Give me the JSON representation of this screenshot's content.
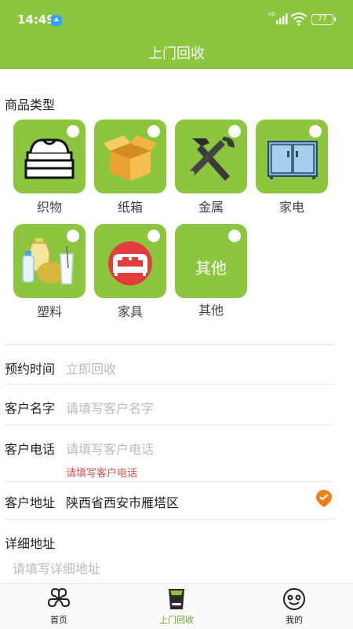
{
  "status_bar": {
    "time": "14:49",
    "battery": "77"
  },
  "header": {
    "title": "上门回收"
  },
  "categories_title": "商品类型",
  "categories": [
    {
      "label": "织物",
      "icon": "folded-clothes-icon"
    },
    {
      "label": "纸箱",
      "icon": "cardboard-box-icon"
    },
    {
      "label": "金属",
      "icon": "hammer-wrench-icon"
    },
    {
      "label": "家电",
      "icon": "appliance-icon"
    },
    {
      "label": "塑料",
      "icon": "plastic-bottles-icon"
    },
    {
      "label": "家具",
      "icon": "sofa-icon"
    },
    {
      "label": "其他",
      "tile_text": "其他"
    }
  ],
  "form": {
    "time": {
      "label": "预约时间",
      "placeholder": "立即回收"
    },
    "name": {
      "label": "客户名字",
      "placeholder": "请填写客户名字"
    },
    "phone": {
      "label": "客户电话",
      "placeholder": "请填写客户电话",
      "error": "请填写客户电话"
    },
    "address": {
      "label": "客户地址",
      "value": "陕西省西安市雁塔区"
    },
    "detail": {
      "label": "详细地址",
      "placeholder": "请填写详细地址"
    }
  },
  "tabbar": [
    {
      "label": "首页",
      "icon": "clover-grid-icon",
      "active": false
    },
    {
      "label": "上门回收",
      "icon": "recycle-bin-icon",
      "active": true
    },
    {
      "label": "我的",
      "icon": "smiley-face-icon",
      "active": false
    }
  ],
  "colors": {
    "brand": "#8cc63f",
    "error": "#e05050",
    "pin": "#f07d18"
  }
}
